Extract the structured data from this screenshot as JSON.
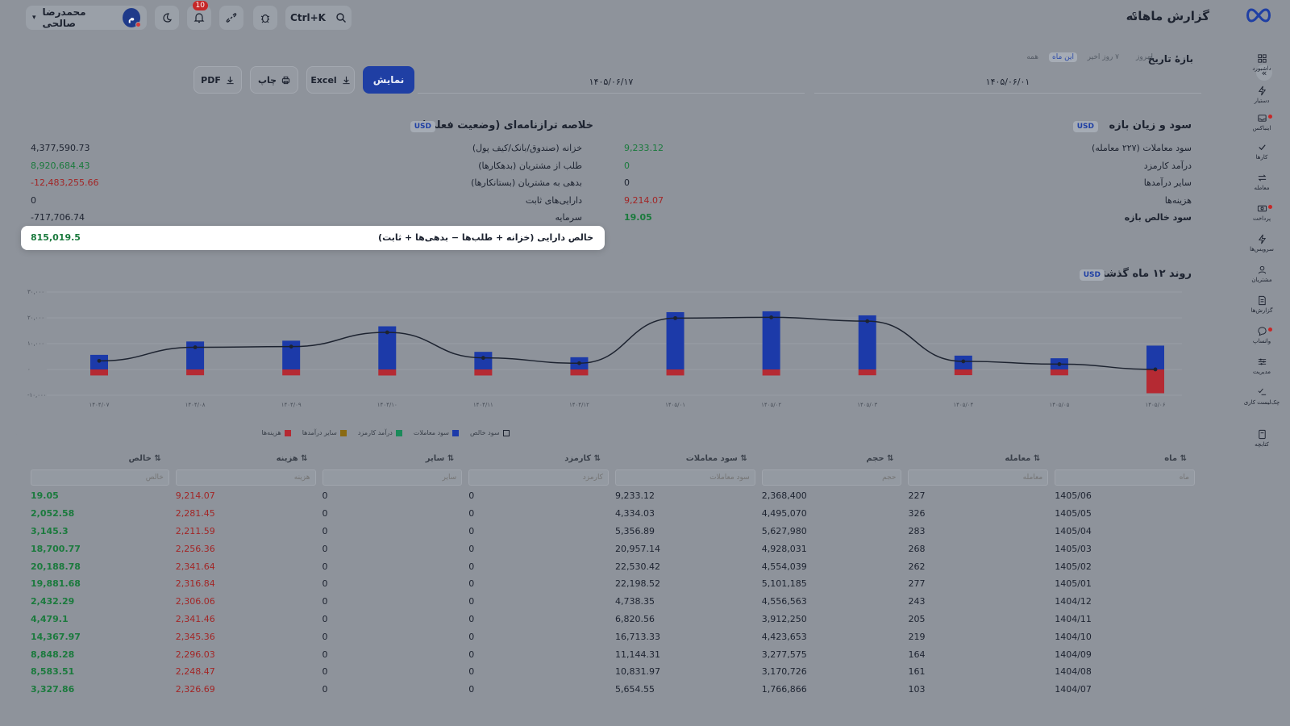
{
  "header": {
    "title": "گزارش ماهانه",
    "help": "؟",
    "search_shortcut": "Ctrl+K",
    "notifications_count": "10",
    "user_name": "محمدرضا صالحی",
    "user_initial": "م",
    "dropdown_caret": "▾"
  },
  "sidebar": {
    "collapse": "«",
    "items": [
      {
        "label": "داشبورد",
        "icon": "dashboard-icon"
      },
      {
        "label": "دستیار",
        "icon": "bolt-icon"
      },
      {
        "label": "اینباکس",
        "icon": "inbox-icon"
      },
      {
        "label": "کارها",
        "icon": "check-icon"
      },
      {
        "label": "معامله",
        "icon": "exchange-icon"
      },
      {
        "label": "پرداخت",
        "icon": "payment-icon"
      },
      {
        "label": "سرویس‌ها",
        "icon": "bolt-icon"
      },
      {
        "label": "مشتریان",
        "icon": "users-icon"
      },
      {
        "label": "گزارش‌ها",
        "icon": "report-icon"
      },
      {
        "label": "واتساپ",
        "icon": "chat-icon"
      },
      {
        "label": "مدیریت",
        "icon": "manage-icon"
      },
      {
        "label": "چک‌لیست کاری",
        "icon": "checklist-icon"
      },
      {
        "label": "کتابچه",
        "icon": "book-icon"
      }
    ]
  },
  "filter": {
    "range_label": "بازهٔ تاریخ",
    "quick_ranges": [
      "امروز",
      "۷ روز اخیر",
      "این ماه",
      "همه"
    ],
    "active_range": "این ماه",
    "date_from": "۱۴۰۵/۰۶/۰۱",
    "date_to": "۱۴۰۵/۰۶/۱۷",
    "show_label": "نمایش",
    "excel_label": "Excel",
    "print_label": "چاپ",
    "pdf_label": "PDF"
  },
  "pl": {
    "title": "سود و زیان بازه",
    "currency": "USD",
    "rows": [
      {
        "label": "سود معاملات (۲۲۷ معامله)",
        "value": "9,233.12",
        "tone": "green"
      },
      {
        "label": "درآمد کارمزد",
        "value": "0",
        "tone": "green"
      },
      {
        "label": "سایر درآمدها",
        "value": "0",
        "tone": "plain"
      },
      {
        "label": "هزینه‌ها",
        "value": "9,214.07",
        "tone": "red"
      },
      {
        "label": "سود خالص بازه",
        "value": "19.05",
        "tone": "green-bold"
      }
    ]
  },
  "bs": {
    "title": "خلاصه ترازنامه‌ای (وضعیت فعلی)",
    "currency": "USD",
    "rows": [
      {
        "label": "خزانه (صندوق/بانک/کیف پول)",
        "value": "4,377,590.73",
        "tone": "plain"
      },
      {
        "label": "طلب از مشتریان (بدهکارها)",
        "value": "8,920,684.43",
        "tone": "green"
      },
      {
        "label": "بدهی به مشتریان (بستانکارها)",
        "value": "-12,483,255.66",
        "tone": "red"
      },
      {
        "label": "دارایی‌های ثابت",
        "value": "0",
        "tone": "plain"
      },
      {
        "label": "سرمایه",
        "value": "-717,706.74",
        "tone": "plain"
      }
    ],
    "net_label": "خالص دارایی (خزانه + طلب‌ها − بدهی‌ها + ثابت)",
    "net_value": "815,019.5"
  },
  "chart_title": "روند ۱۲ ماه گذشته",
  "chart_currency": "USD",
  "chart_data": {
    "type": "bar",
    "categories": [
      "۱۴۰۴/۰۷",
      "۱۴۰۴/۰۸",
      "۱۴۰۴/۰۹",
      "۱۴۰۴/۱۰",
      "۱۴۰۴/۱۱",
      "۱۴۰۴/۱۲",
      "۱۴۰۵/۰۱",
      "۱۴۰۵/۰۲",
      "۱۴۰۵/۰۳",
      "۱۴۰۵/۰۴",
      "۱۴۰۵/۰۵",
      "۱۴۰۵/۰۶"
    ],
    "y_ticks": [
      "۳۰,۰۰۰",
      "۲۰,۰۰۰",
      "۱۰,۰۰۰",
      "۰",
      "-۱۰,۰۰۰"
    ],
    "ylim": [
      -10000,
      30000
    ],
    "series": [
      {
        "name": "سود معاملات",
        "kind": "bar",
        "color": "#1c3aa9",
        "values": [
          5654.55,
          10831.97,
          11144.31,
          16713.33,
          6820.56,
          4738.35,
          22198.52,
          22530.42,
          20957.14,
          5356.89,
          4334.03,
          9233.12
        ]
      },
      {
        "name": "درآمد کارمزد",
        "kind": "bar",
        "color": "#1b8a5a",
        "values": [
          0,
          0,
          0,
          0,
          0,
          0,
          0,
          0,
          0,
          0,
          0,
          0
        ]
      },
      {
        "name": "سایر درآمدها",
        "kind": "bar",
        "color": "#8a6a12",
        "values": [
          0,
          0,
          0,
          0,
          0,
          0,
          0,
          0,
          0,
          0,
          0,
          0
        ]
      },
      {
        "name": "هزینه‌ها",
        "kind": "bar",
        "color": "#b52a33",
        "values": [
          -2326.69,
          -2248.47,
          -2296.03,
          -2345.36,
          -2341.46,
          -2306.06,
          -2316.84,
          -2341.64,
          -2256.36,
          -2211.59,
          -2281.45,
          -9214.07
        ]
      },
      {
        "name": "سود خالص",
        "kind": "line",
        "color": "#1d2330",
        "values": [
          3327.86,
          8583.51,
          8848.28,
          14367.97,
          4479.1,
          2432.29,
          19881.68,
          20188.78,
          18700.77,
          3145.3,
          2052.58,
          19.05
        ]
      }
    ]
  },
  "table": {
    "columns": [
      "ماه",
      "معامله",
      "حجم",
      "سود معاملات",
      "کارمزد",
      "سایر",
      "هزینه",
      "خالص"
    ],
    "sort_icon": "⇅",
    "rows": [
      [
        "1405/06",
        "227",
        "2,368,400",
        "9,233.12",
        "0",
        "0",
        "9,214.07",
        "19.05"
      ],
      [
        "1405/05",
        "326",
        "4,495,070",
        "4,334.03",
        "0",
        "0",
        "2,281.45",
        "2,052.58"
      ],
      [
        "1405/04",
        "283",
        "5,627,980",
        "5,356.89",
        "0",
        "0",
        "2,211.59",
        "3,145.3"
      ],
      [
        "1405/03",
        "268",
        "4,928,031",
        "20,957.14",
        "0",
        "0",
        "2,256.36",
        "18,700.77"
      ],
      [
        "1405/02",
        "262",
        "4,554,039",
        "22,530.42",
        "0",
        "0",
        "2,341.64",
        "20,188.78"
      ],
      [
        "1405/01",
        "277",
        "5,101,185",
        "22,198.52",
        "0",
        "0",
        "2,316.84",
        "19,881.68"
      ],
      [
        "1404/12",
        "243",
        "4,556,563",
        "4,738.35",
        "0",
        "0",
        "2,306.06",
        "2,432.29"
      ],
      [
        "1404/11",
        "205",
        "3,912,250",
        "6,820.56",
        "0",
        "0",
        "2,341.46",
        "4,479.1"
      ],
      [
        "1404/10",
        "219",
        "4,423,653",
        "16,713.33",
        "0",
        "0",
        "2,345.36",
        "14,367.97"
      ],
      [
        "1404/09",
        "164",
        "3,277,575",
        "11,144.31",
        "0",
        "0",
        "2,296.03",
        "8,848.28"
      ],
      [
        "1404/08",
        "161",
        "3,170,726",
        "10,831.97",
        "0",
        "0",
        "2,248.47",
        "8,583.51"
      ],
      [
        "1404/07",
        "103",
        "1,766,866",
        "5,654.55",
        "0",
        "0",
        "2,326.69",
        "3,327.86"
      ]
    ]
  }
}
